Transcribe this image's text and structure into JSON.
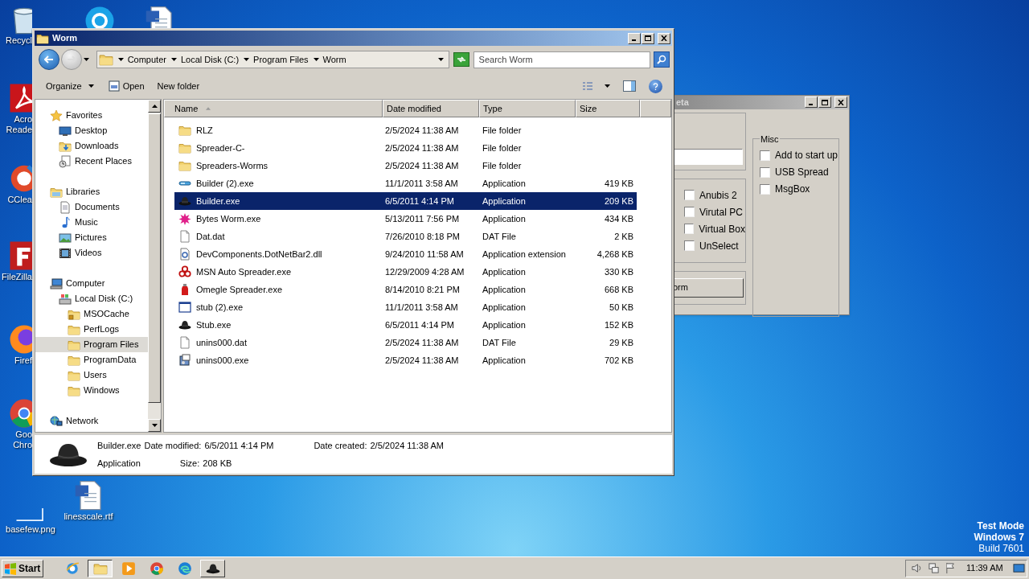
{
  "desktop": {
    "icons": [
      {
        "kind": "trash",
        "label_lines": [
          "Recycl"
        ]
      },
      {
        "kind": "chat"
      },
      {
        "kind": "word"
      },
      {
        "kind": "pdf",
        "label_lines": [
          "Acro",
          "Reade"
        ]
      },
      {
        "kind": "cleaner",
        "label_lines": [
          "CClea"
        ]
      },
      {
        "kind": "ftp",
        "label_lines": [
          "FileZilla"
        ]
      },
      {
        "kind": "fox",
        "label_lines": [
          "Firef"
        ]
      },
      {
        "kind": "chrome",
        "label_lines": [
          "Goo",
          "Chro"
        ]
      },
      {
        "kind": "image",
        "label_lines": [
          "basefew.png"
        ]
      },
      {
        "kind": "word",
        "label_lines": [
          "linesscale.rtf"
        ]
      }
    ]
  },
  "builder_window": {
    "title": "eta",
    "option_checkboxes": [
      {
        "label": "Anubis 2",
        "checked": false
      },
      {
        "label": "Virutal PC",
        "checked": false
      },
      {
        "label": "Virtual Box",
        "checked": false
      },
      {
        "label": "UnSelect",
        "checked": false
      }
    ],
    "misc": {
      "title": "Misc",
      "checkboxes": [
        {
          "label": "Add to start up",
          "checked": false
        },
        {
          "label": "USB Spread",
          "checked": false
        },
        {
          "label": "MsgBox",
          "checked": false
        }
      ]
    },
    "button": "orm"
  },
  "explorer": {
    "title": "Worm",
    "breadcrumb": [
      "Computer",
      "Local Disk (C:)",
      "Program Files",
      "Worm"
    ],
    "search": {
      "placeholder": "Search Worm"
    },
    "toolbar": [
      "Organize",
      "Open",
      "New folder"
    ],
    "nav": [
      {
        "label": "Favorites",
        "kind": "star",
        "selected": false,
        "children": [
          {
            "label": "Desktop",
            "kind": "desktop",
            "selected": false
          },
          {
            "label": "Downloads",
            "kind": "downloads",
            "selected": false
          },
          {
            "label": "Recent Places",
            "kind": "recent",
            "selected": false
          }
        ]
      },
      {
        "label": "Libraries",
        "kind": "library",
        "selected": false,
        "children": [
          {
            "label": "Documents",
            "kind": "doc",
            "selected": false
          },
          {
            "label": "Music",
            "kind": "music",
            "selected": false
          },
          {
            "label": "Pictures",
            "kind": "pictures",
            "selected": false
          },
          {
            "label": "Videos",
            "kind": "videos",
            "selected": false
          }
        ]
      },
      {
        "label": "Computer",
        "kind": "computer",
        "selected": false,
        "children": [
          {
            "label": "Local Disk (C:)",
            "kind": "disk",
            "selected": false,
            "children": [
              {
                "label": "MSOCache",
                "kind": "locked",
                "selected": false
              },
              {
                "label": "PerfLogs",
                "kind": "folder",
                "selected": false
              },
              {
                "label": "Program Files",
                "kind": "folder",
                "selected": true
              },
              {
                "label": "ProgramData",
                "kind": "folder",
                "selected": false
              },
              {
                "label": "Users",
                "kind": "folder",
                "selected": false
              },
              {
                "label": "Windows",
                "kind": "folder",
                "selected": false
              }
            ]
          }
        ]
      },
      {
        "label": "Network",
        "kind": "network",
        "selected": false
      }
    ],
    "columns": [
      "Name",
      "Date modified",
      "Type",
      "Size"
    ],
    "rows": [
      {
        "name": "RLZ",
        "date": "2/5/2024 11:38 AM",
        "type": "File folder",
        "kind": "folder",
        "selected": false
      },
      {
        "name": "Spreader-C-",
        "date": "2/5/2024 11:38 AM",
        "type": "File folder",
        "kind": "folder",
        "selected": false
      },
      {
        "name": "Spreaders-Worms",
        "date": "2/5/2024 11:38 AM",
        "type": "File folder",
        "kind": "folder",
        "selected": false
      },
      {
        "name": "Builder (2).exe",
        "date": "11/1/2011 3:58 AM",
        "type": "Application",
        "size": "419 KB",
        "kind": "app",
        "selected": false
      },
      {
        "name": "Builder.exe",
        "date": "6/5/2011 4:14 PM",
        "type": "Application",
        "size": "209 KB",
        "kind": "hat",
        "selected": true
      },
      {
        "name": "Bytes Worm.exe",
        "date": "5/13/2011 7:56 PM",
        "type": "Application",
        "size": "434 KB",
        "kind": "splat",
        "selected": false
      },
      {
        "name": "Dat.dat",
        "date": "7/26/2010 8:18 PM",
        "type": "DAT File",
        "size": "2 KB",
        "kind": "file",
        "selected": false
      },
      {
        "name": "DevComponents.DotNetBar2.dll",
        "date": "9/24/2010 11:58 AM",
        "type": "Application extension",
        "size": "4,268 KB",
        "kind": "dll",
        "selected": false
      },
      {
        "name": "MSN Auto Spreader.exe",
        "date": "12/29/2009 4:28 AM",
        "type": "Application",
        "size": "330 KB",
        "kind": "hazard",
        "selected": false
      },
      {
        "name": "Omegle Spreader.exe",
        "date": "8/14/2010 8:21 PM",
        "type": "Application",
        "size": "668 KB",
        "kind": "bottle",
        "selected": false
      },
      {
        "name": "stub (2).exe",
        "date": "11/1/2011 3:58 AM",
        "type": "Application",
        "size": "50 KB",
        "kind": "window",
        "selected": false
      },
      {
        "name": "Stub.exe",
        "date": "6/5/2011 4:14 PM",
        "type": "Application",
        "size": "152 KB",
        "kind": "hat",
        "selected": false
      },
      {
        "name": "unins000.dat",
        "date": "2/5/2024 11:38 AM",
        "type": "DAT File",
        "size": "29 KB",
        "kind": "file",
        "selected": false
      },
      {
        "name": "unins000.exe",
        "date": "2/5/2024 11:38 AM",
        "type": "Application",
        "size": "702 KB",
        "kind": "installer",
        "selected": false
      }
    ],
    "details": {
      "name": "Builder.exe",
      "type": "Application",
      "modified_label": "Date modified:",
      "modified": "6/5/2011 4:14 PM",
      "size_label": "Size:",
      "size": "208 KB",
      "created_label": "Date created:",
      "created": "2/5/2024 11:38 AM"
    }
  },
  "taskbar": {
    "start": "Start",
    "items": [
      {
        "kind": "ie",
        "selected": false,
        "open": false
      },
      {
        "kind": "folder",
        "selected": true,
        "open": true
      },
      {
        "kind": "media",
        "selected": false,
        "open": false
      },
      {
        "kind": "chrome",
        "selected": false,
        "open": false
      },
      {
        "kind": "edge",
        "selected": false,
        "open": false
      },
      {
        "kind": "hat",
        "selected": false,
        "open": true
      }
    ],
    "clock": "11:39 AM"
  },
  "os_notice": [
    "Test Mode",
    "Windows 7",
    "Build 7601"
  ]
}
